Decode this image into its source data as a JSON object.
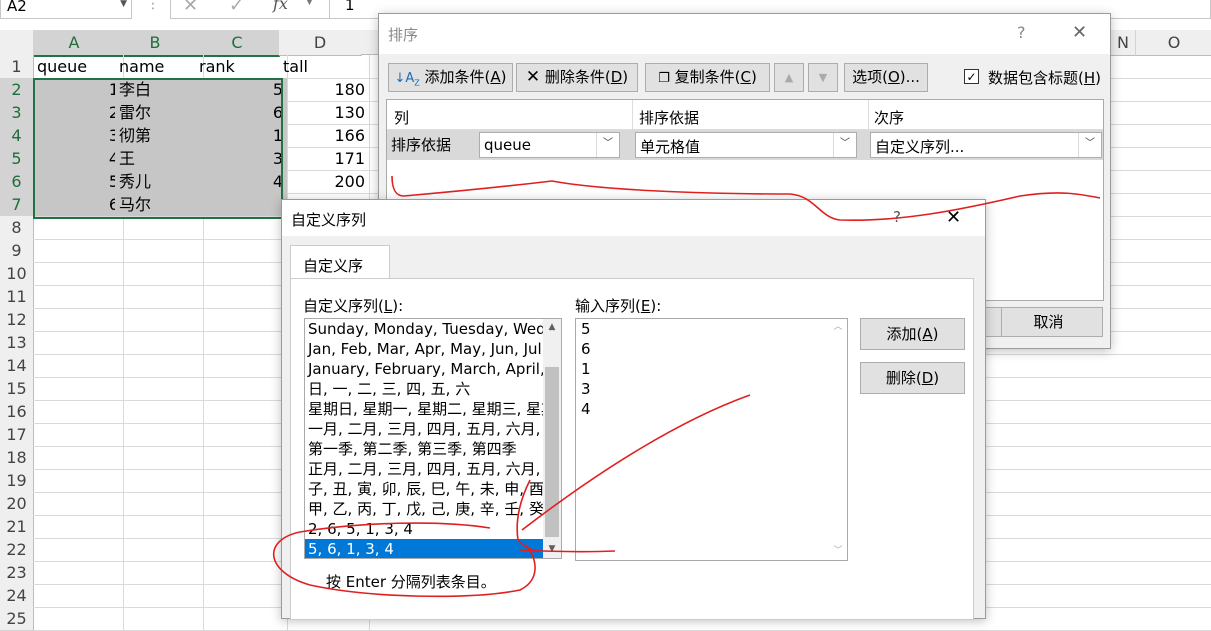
{
  "formula_bar": {
    "name_box": "A2",
    "cancel_glyph": "✕",
    "enter_glyph": "✓",
    "fx_label": "fx",
    "value": "1"
  },
  "sheet": {
    "columns": [
      "A",
      "B",
      "C",
      "D",
      "N",
      "O"
    ],
    "rows": [
      "1",
      "2",
      "3",
      "4",
      "5",
      "6",
      "7",
      "8",
      "9",
      "10",
      "11",
      "12",
      "13",
      "14",
      "15",
      "16",
      "17",
      "18",
      "19",
      "20",
      "21",
      "22",
      "23",
      "24",
      "25"
    ],
    "header_row": {
      "a": "queue",
      "b": "name",
      "c": "rank",
      "d": "tall"
    },
    "data": [
      {
        "a": "1",
        "b": "李白",
        "c": "5",
        "d": "180"
      },
      {
        "a": "2",
        "b": "雷尔",
        "c": "6",
        "d": "130"
      },
      {
        "a": "3",
        "b": "彻第",
        "c": "1",
        "d": "166"
      },
      {
        "a": "4",
        "b": "王",
        "c": "3",
        "d": "171"
      },
      {
        "a": "5",
        "b": "秀儿",
        "c": "4",
        "d": "200"
      },
      {
        "a": "6",
        "b": "马尔",
        "c": "",
        "d": ""
      }
    ]
  },
  "sort_dialog": {
    "title": "排序",
    "help": "?",
    "close": "✕",
    "add_level": "添加条件(",
    "add_level_key": "A",
    "delete_level": "删除条件(",
    "delete_level_key": "D",
    "copy_level": "复制条件(",
    "copy_level_key": "C",
    "options": "选项(",
    "options_key": "O",
    "options_suffix": ")...",
    "has_headers": "数据包含标题(",
    "has_headers_key": "H",
    "paren_close": ")",
    "col_header_column": "列",
    "col_header_sort_on": "排序依据",
    "col_header_order": "次序",
    "row_label": "排序依据",
    "column_value": "queue",
    "sort_on_value": "单元格值",
    "order_value": "自定义序列...",
    "cancel": "取消"
  },
  "custom_lists_dialog": {
    "title": "自定义序列",
    "help": "?",
    "close": "✕",
    "tab": "自定义序列",
    "lists_label": "自定义序列(",
    "lists_label_key": "L",
    "lists_label_suffix": "):",
    "entries_label": "输入序列(",
    "entries_label_key": "E",
    "entries_label_suffix": "):",
    "lists": [
      "Sunday, Monday, Tuesday, Wednesday",
      "Jan, Feb, Mar, Apr, May, Jun, Jul, Aug",
      "January, February, March, April, May",
      "日, 一, 二, 三, 四, 五, 六",
      "星期日, 星期一, 星期二, 星期三, 星期四",
      "一月, 二月, 三月, 四月, 五月, 六月, 七月",
      "第一季, 第二季, 第三季, 第四季",
      "正月, 二月, 三月, 四月, 五月, 六月, 七月",
      "子, 丑, 寅, 卯, 辰, 巳, 午, 未, 申, 酉, 戌",
      "甲, 乙, 丙, 丁, 戊, 己, 庚, 辛, 壬, 癸",
      "2, 6, 5, 1, 3, 4",
      "5, 6, 1, 3, 4"
    ],
    "entries": [
      "5",
      "6",
      "1",
      "3",
      "4"
    ],
    "add_button": "添加(",
    "add_key": "A",
    "delete_button": "删除(",
    "delete_key": "D",
    "hint": "按 Enter 分隔列表条目。"
  },
  "colors": {
    "selection_green": "#217346",
    "highlight_gray": "#c6c6c6",
    "list_selected_blue": "#0078d7",
    "annotation_red": "#e02020"
  }
}
